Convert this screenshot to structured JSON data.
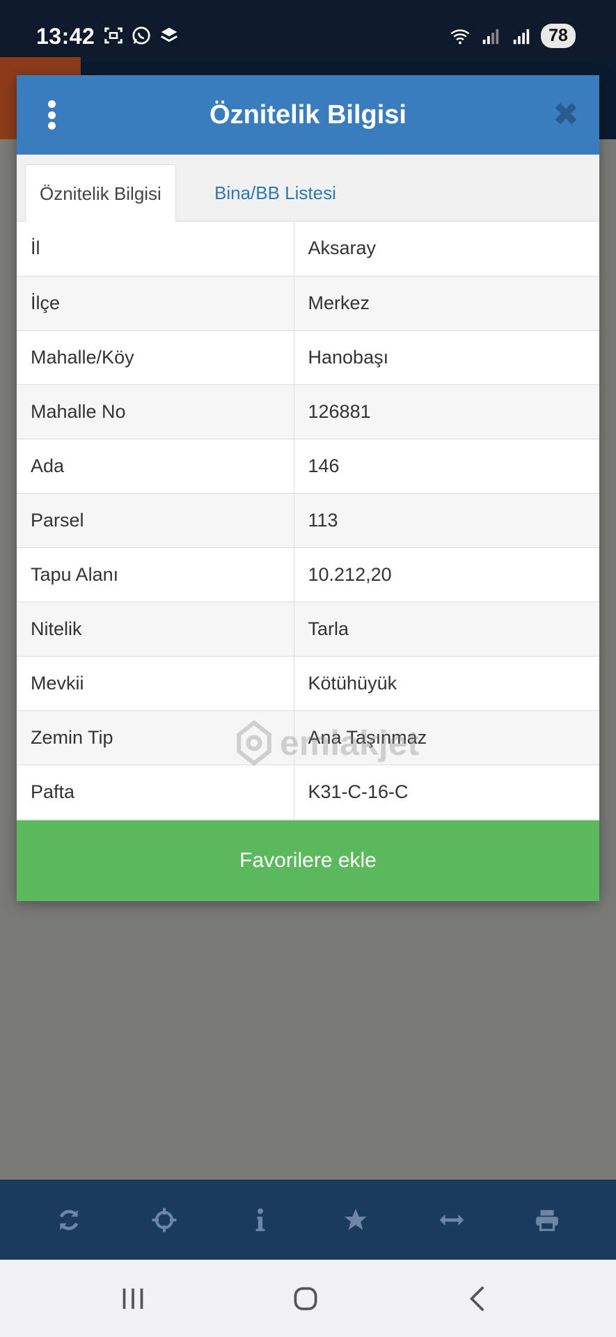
{
  "status_bar": {
    "time": "13:42",
    "battery": "78",
    "left_icons": [
      "screenshot-icon",
      "whatsapp-icon",
      "layers-icon"
    ],
    "right_icons": [
      "wifi-icon",
      "signal-icon",
      "signal-icon"
    ]
  },
  "modal": {
    "title": "Öznitelik Bilgisi",
    "menu_icon": "more-vertical-icon",
    "close_icon": "close-icon",
    "close_glyph": "✖",
    "tabs": [
      {
        "label": "Öznitelik Bilgisi",
        "active": true
      },
      {
        "label": "Bina/BB Listesi",
        "active": false
      }
    ],
    "attributes": [
      {
        "key": "İl",
        "value": "Aksaray"
      },
      {
        "key": "İlçe",
        "value": "Merkez"
      },
      {
        "key": "Mahalle/Köy",
        "value": "Hanobaşı"
      },
      {
        "key": "Mahalle No",
        "value": "126881"
      },
      {
        "key": "Ada",
        "value": "146"
      },
      {
        "key": "Parsel",
        "value": "113"
      },
      {
        "key": "Tapu Alanı",
        "value": "10.212,20"
      },
      {
        "key": "Nitelik",
        "value": "Tarla"
      },
      {
        "key": "Mevkii",
        "value": "Kötühüyük"
      },
      {
        "key": "Zemin Tip",
        "value": "Ana Taşınmaz"
      },
      {
        "key": "Pafta",
        "value": "K31-C-16-C"
      }
    ],
    "favorite_button": "Favorilere ekle"
  },
  "watermark": {
    "text": "emlakjet"
  },
  "toolbar": {
    "icons": [
      "refresh-icon",
      "crosshair-icon",
      "info-icon",
      "star-icon",
      "measure-icon",
      "print-icon"
    ]
  },
  "navbar": {
    "icons": [
      "recent-apps-icon",
      "home-icon",
      "back-icon"
    ]
  },
  "colors": {
    "header_blue": "#3a7dbf",
    "button_green": "#5cb85c",
    "toolbar_navy": "#1a3a5e",
    "tab_link": "#2d76ba"
  }
}
